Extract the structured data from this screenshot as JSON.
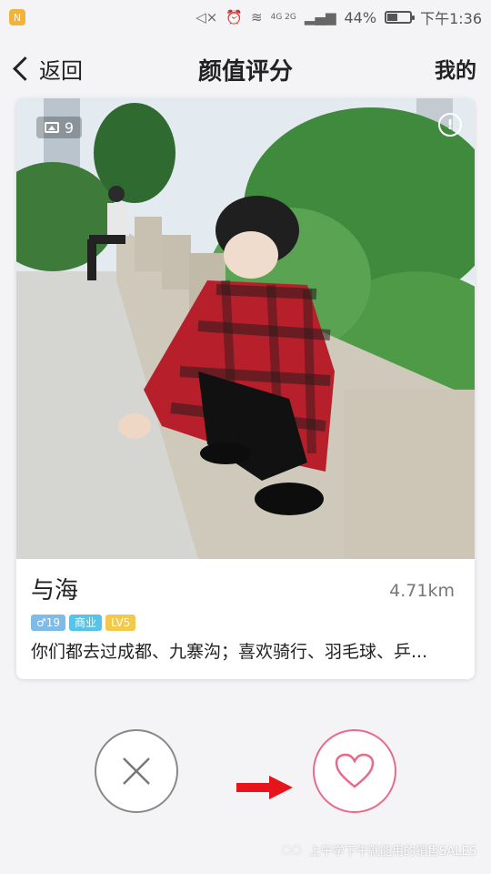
{
  "status_bar": {
    "app_badge": "N",
    "network": "4G 2G",
    "battery_percent_text": "44%",
    "battery_level": 0.44,
    "time": "下午1:36"
  },
  "nav": {
    "back_label": "返回",
    "title": "颜值评分",
    "mine_label": "我的"
  },
  "card": {
    "photo_count": "9",
    "report_icon_text": "!",
    "name": "与海",
    "distance": "4.71km",
    "tags": {
      "gender_age": "♂19",
      "category": "商业",
      "level": "LV5"
    },
    "bio": "你们都去过成都、九寨沟；喜欢骑行、羽毛球、乒..."
  },
  "actions": {
    "dislike_icon": "close-icon",
    "like_icon": "heart-icon"
  },
  "colors": {
    "like_accent": "#e86a8a",
    "arrow": "#e8141c",
    "tag_gender": "#7fbbe6",
    "tag_biz": "#58c3e6",
    "tag_level": "#f2c94c"
  },
  "watermark": {
    "text": "上午学下午就能用的销售SALES"
  }
}
